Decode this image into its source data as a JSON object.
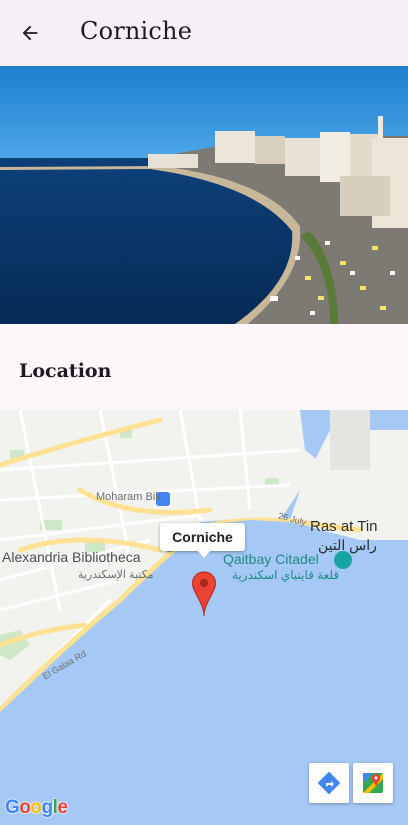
{
  "appbar": {
    "title": "Corniche",
    "back_icon": "arrow-back-icon"
  },
  "hero": {
    "image_alt": "Corniche"
  },
  "location": {
    "heading": "Location"
  },
  "map": {
    "info_window": "Corniche",
    "labels": {
      "bibliotheca_en": "Alexandria Bibliotheca",
      "bibliotheca_ar": "مكتبة الإسكندرية",
      "qaitbay_en": "Qaitbay Citadel",
      "qaitbay_ar": "قلعة قايتباي اسكندرية",
      "ras_en": "Ras at Tin",
      "ras_ar": "راس التين",
      "moharam": "Moharam Bik",
      "street_26": "26 July",
      "el_galaa": "El Galaa Rd"
    },
    "google": [
      "G",
      "o",
      "o",
      "g",
      "l",
      "e"
    ],
    "colors": {
      "water": "#a6c8f4",
      "land": "#f2f2ee",
      "road": "#fde293",
      "marker": "#ea4335"
    }
  }
}
